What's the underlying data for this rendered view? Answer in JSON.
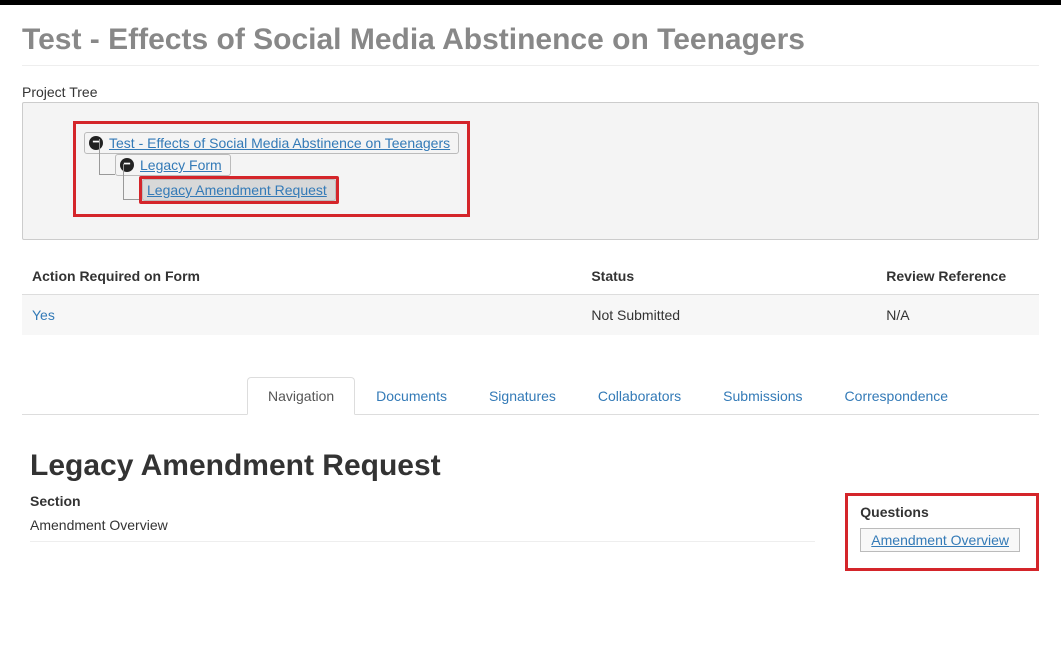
{
  "page_title": "Test - Effects of Social Media Abstinence on Teenagers",
  "project_tree": {
    "label": "Project Tree",
    "root": {
      "label": "Test - Effects of Social Media Abstinence on Teenagers",
      "child": {
        "label": "Legacy Form",
        "child": {
          "label": "Legacy Amendment Request"
        }
      }
    }
  },
  "status_table": {
    "headers": {
      "action": "Action Required on Form",
      "status": "Status",
      "ref": "Review Reference"
    },
    "row": {
      "action": "Yes",
      "status": "Not Submitted",
      "ref": "N/A"
    }
  },
  "tabs": [
    "Navigation",
    "Documents",
    "Signatures",
    "Collaborators",
    "Submissions",
    "Correspondence"
  ],
  "active_tab": "Navigation",
  "form": {
    "title": "Legacy Amendment Request",
    "section_header": "Section",
    "section_value": "Amendment Overview",
    "questions_header": "Questions",
    "question_link": "Amendment Overview"
  }
}
